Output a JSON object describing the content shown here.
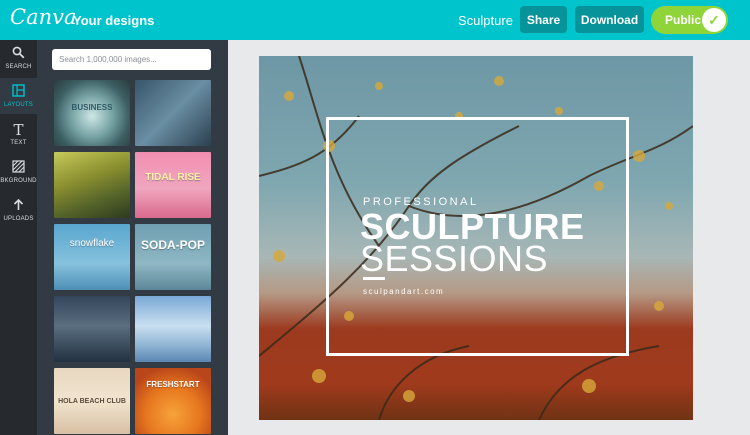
{
  "app": {
    "logo": "Canva",
    "nav_link": "Your designs"
  },
  "toolbar": {
    "doc_title": "Sculpture",
    "share_label": "Share",
    "download_label": "Download",
    "public_label": "Public",
    "public_on": true
  },
  "rail": {
    "items": [
      {
        "label": "SEARCH",
        "icon": "search-icon"
      },
      {
        "label": "LAYOUTS",
        "icon": "layouts-icon",
        "active": true
      },
      {
        "label": "TEXT",
        "icon": "text-icon"
      },
      {
        "label": "BKGROUND",
        "icon": "background-icon"
      },
      {
        "label": "UPLOADS",
        "icon": "upload-icon"
      }
    ]
  },
  "panel": {
    "search_placeholder": "Search 1,000,000 images...",
    "thumbnails": [
      {
        "text": "BUSINESS"
      },
      {
        "text": ""
      },
      {
        "text": ""
      },
      {
        "text": "TIDAL RISE"
      },
      {
        "text": "snowflake"
      },
      {
        "text": "SODA-POP"
      },
      {
        "text": ""
      },
      {
        "text": ""
      },
      {
        "text": "HOLA BEACH CLUB"
      },
      {
        "text": "FRESHSTART"
      }
    ]
  },
  "design": {
    "eyebrow": "PROFESSIONAL",
    "title_line1": "SCULPTURE",
    "title_line2": "SESSIONS",
    "url": "sculpandart.com"
  },
  "colors": {
    "brand": "#00c4cc",
    "button_dark": "#06939a",
    "toggle_on": "#8fd53a",
    "rail_bg": "#26292d",
    "panel_bg": "#323a44"
  }
}
